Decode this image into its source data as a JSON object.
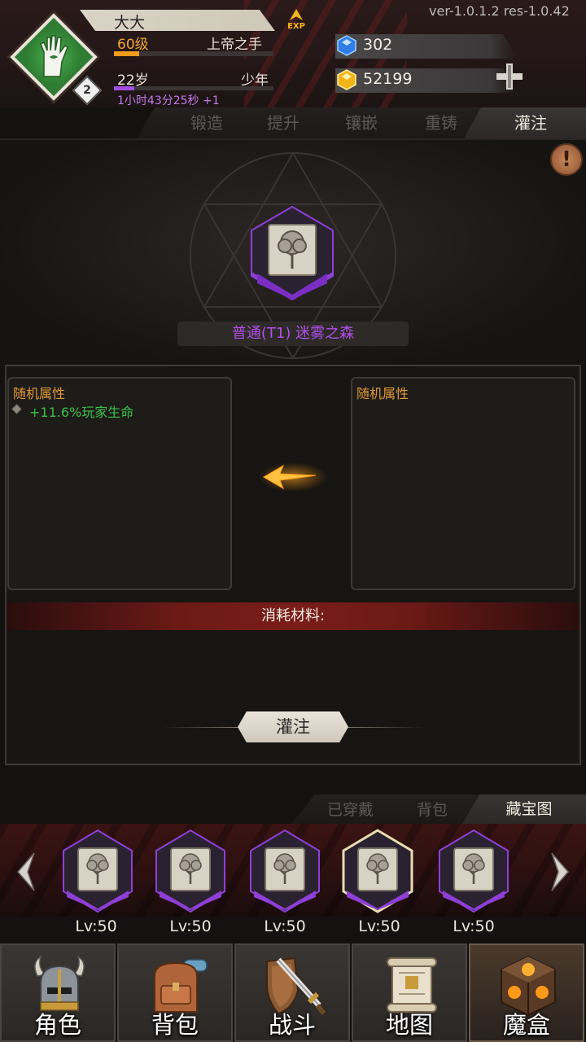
{
  "header": {
    "player_name": "大大",
    "level": "60级",
    "title": "上帝之手",
    "level_progress": 0.16,
    "age": "22岁",
    "stage": "少年",
    "age_progress": 0.13,
    "timer": "1小时43分25秒 +1",
    "avatar_badge": "2",
    "exp_label": "EXP",
    "version": "ver-1.0.1.2  res-1.0.42",
    "gems": "302",
    "gold": "52199"
  },
  "forge_tabs": [
    "锻造",
    "提升",
    "镶嵌",
    "重铸",
    "灌注"
  ],
  "forge_active_tab": "灌注",
  "main": {
    "item_name": "普通(T1) 迷雾之森",
    "info_icon": "exclamation-icon"
  },
  "attributes": {
    "left_title": "随机属性",
    "left_lines": [
      "+11.6%玩家生命"
    ],
    "right_title": "随机属性"
  },
  "cost_label": "消耗材料:",
  "infuse_button": "灌注",
  "inventory_tabs": [
    "已穿戴",
    "背包",
    "藏宝图"
  ],
  "inventory_active_tab": "藏宝图",
  "inventory_items": [
    {
      "level": "Lv:50",
      "selected": false
    },
    {
      "level": "Lv:50",
      "selected": false
    },
    {
      "level": "Lv:50",
      "selected": false
    },
    {
      "level": "Lv:50",
      "selected": true
    },
    {
      "level": "Lv:50",
      "selected": false
    }
  ],
  "bottom_nav": [
    {
      "label": "角色",
      "icon": "helmet-icon"
    },
    {
      "label": "背包",
      "icon": "backpack-icon"
    },
    {
      "label": "战斗",
      "icon": "sword-shield-icon"
    },
    {
      "label": "地图",
      "icon": "scroll-map-icon"
    },
    {
      "label": "魔盒",
      "icon": "magic-box-icon"
    }
  ],
  "colors": {
    "rarity_purple": "#8e3fd6",
    "gold_text": "#f0a830",
    "attr_green": "#3bc04a",
    "timer_purple": "#c27ae8"
  }
}
